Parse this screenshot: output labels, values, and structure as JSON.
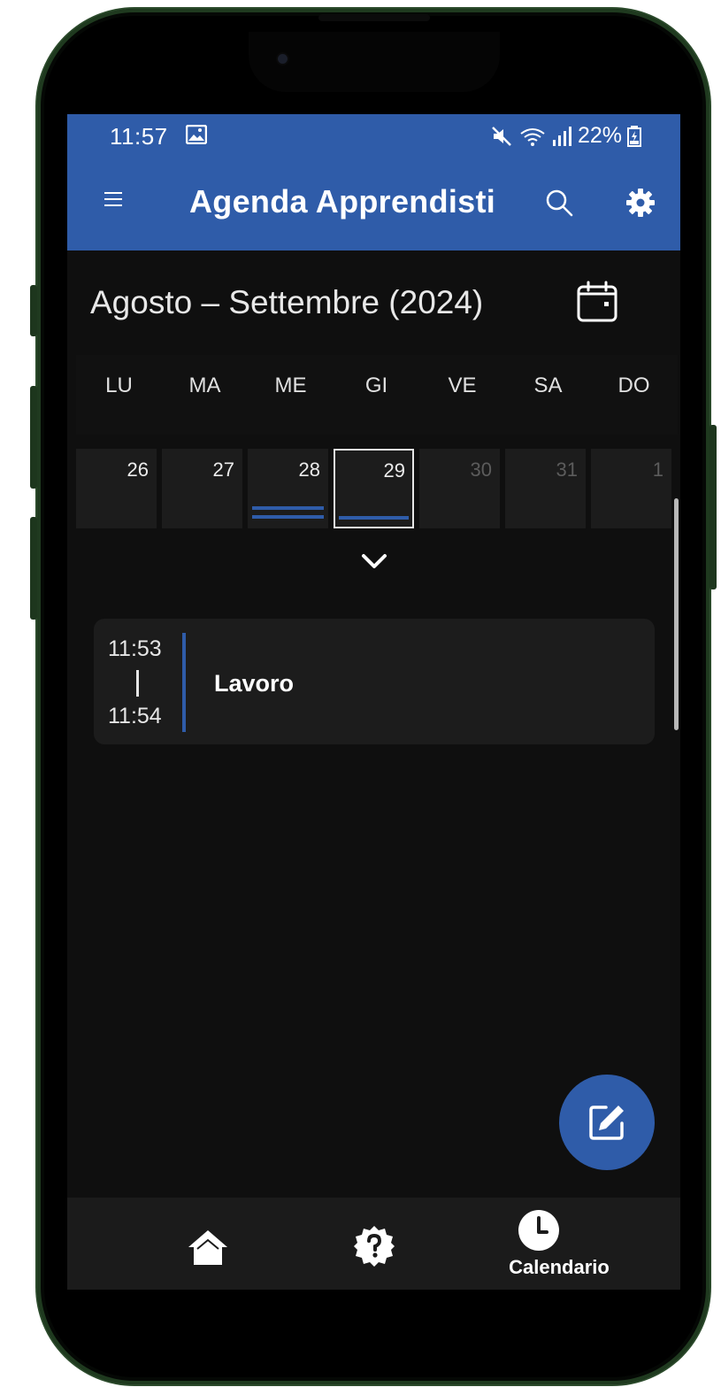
{
  "status_bar": {
    "time": "11:57",
    "battery": "22%"
  },
  "app_bar": {
    "title": "Agenda Apprendisti"
  },
  "calendar": {
    "month_title": "Agosto – Settembre (2024)",
    "weekdays": [
      "LU",
      "MA",
      "ME",
      "GI",
      "VE",
      "SA",
      "DO"
    ],
    "days": [
      "26",
      "27",
      "28",
      "29",
      "30",
      "31",
      "1"
    ],
    "selected_day": "29"
  },
  "events": [
    {
      "start": "11:53",
      "end": "11:54",
      "title": "Lavoro"
    }
  ],
  "bottom_nav": {
    "items": [
      {
        "icon": "home-icon"
      },
      {
        "icon": "help-badge-icon"
      },
      {
        "icon": "clock-icon",
        "label": "Calendario"
      }
    ]
  },
  "colors": {
    "primary": "#2f5ca9",
    "background": "#0f0f0f",
    "card": "#1c1c1c",
    "bottom_nav": "#1b1b1b"
  }
}
